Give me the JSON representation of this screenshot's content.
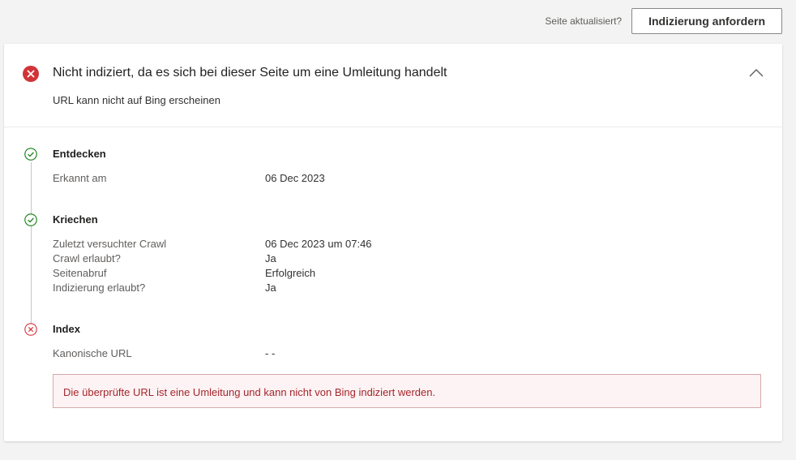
{
  "topbar": {
    "hint": "Seite aktualisiert?",
    "request_button": "Indizierung anfordern"
  },
  "card": {
    "title": "Nicht indiziert, da es sich bei dieser Seite um eine Umleitung handelt",
    "subtitle": "URL kann nicht auf Bing erscheinen"
  },
  "steps": [
    {
      "title": "Entdecken",
      "status": "success",
      "rows": [
        {
          "label": "Erkannt am",
          "value": "06 Dec 2023"
        }
      ]
    },
    {
      "title": "Kriechen",
      "status": "success",
      "rows": [
        {
          "label": "Zuletzt versuchter Crawl",
          "value": "06 Dec 2023 um 07:46"
        },
        {
          "label": "Crawl erlaubt?",
          "value": "Ja"
        },
        {
          "label": "Seitenabruf",
          "value": "Erfolgreich"
        },
        {
          "label": "Indizierung erlaubt?",
          "value": "Ja"
        }
      ]
    },
    {
      "title": "Index",
      "status": "error",
      "rows": [
        {
          "label": "Kanonische URL",
          "value": "- -"
        }
      ]
    }
  ],
  "alert": "Die überprüfte URL ist eine Umleitung und kann nicht von Bing indiziert werden.",
  "colors": {
    "error": "#d13438",
    "success": "#107c10",
    "alert_text": "#a4262c",
    "alert_border": "#d9a8aa"
  },
  "icons": {
    "status": "error-circle-icon",
    "collapse": "chevron-up-icon",
    "step_success": "check-circle-icon",
    "step_error": "error-circle-outline-icon"
  }
}
